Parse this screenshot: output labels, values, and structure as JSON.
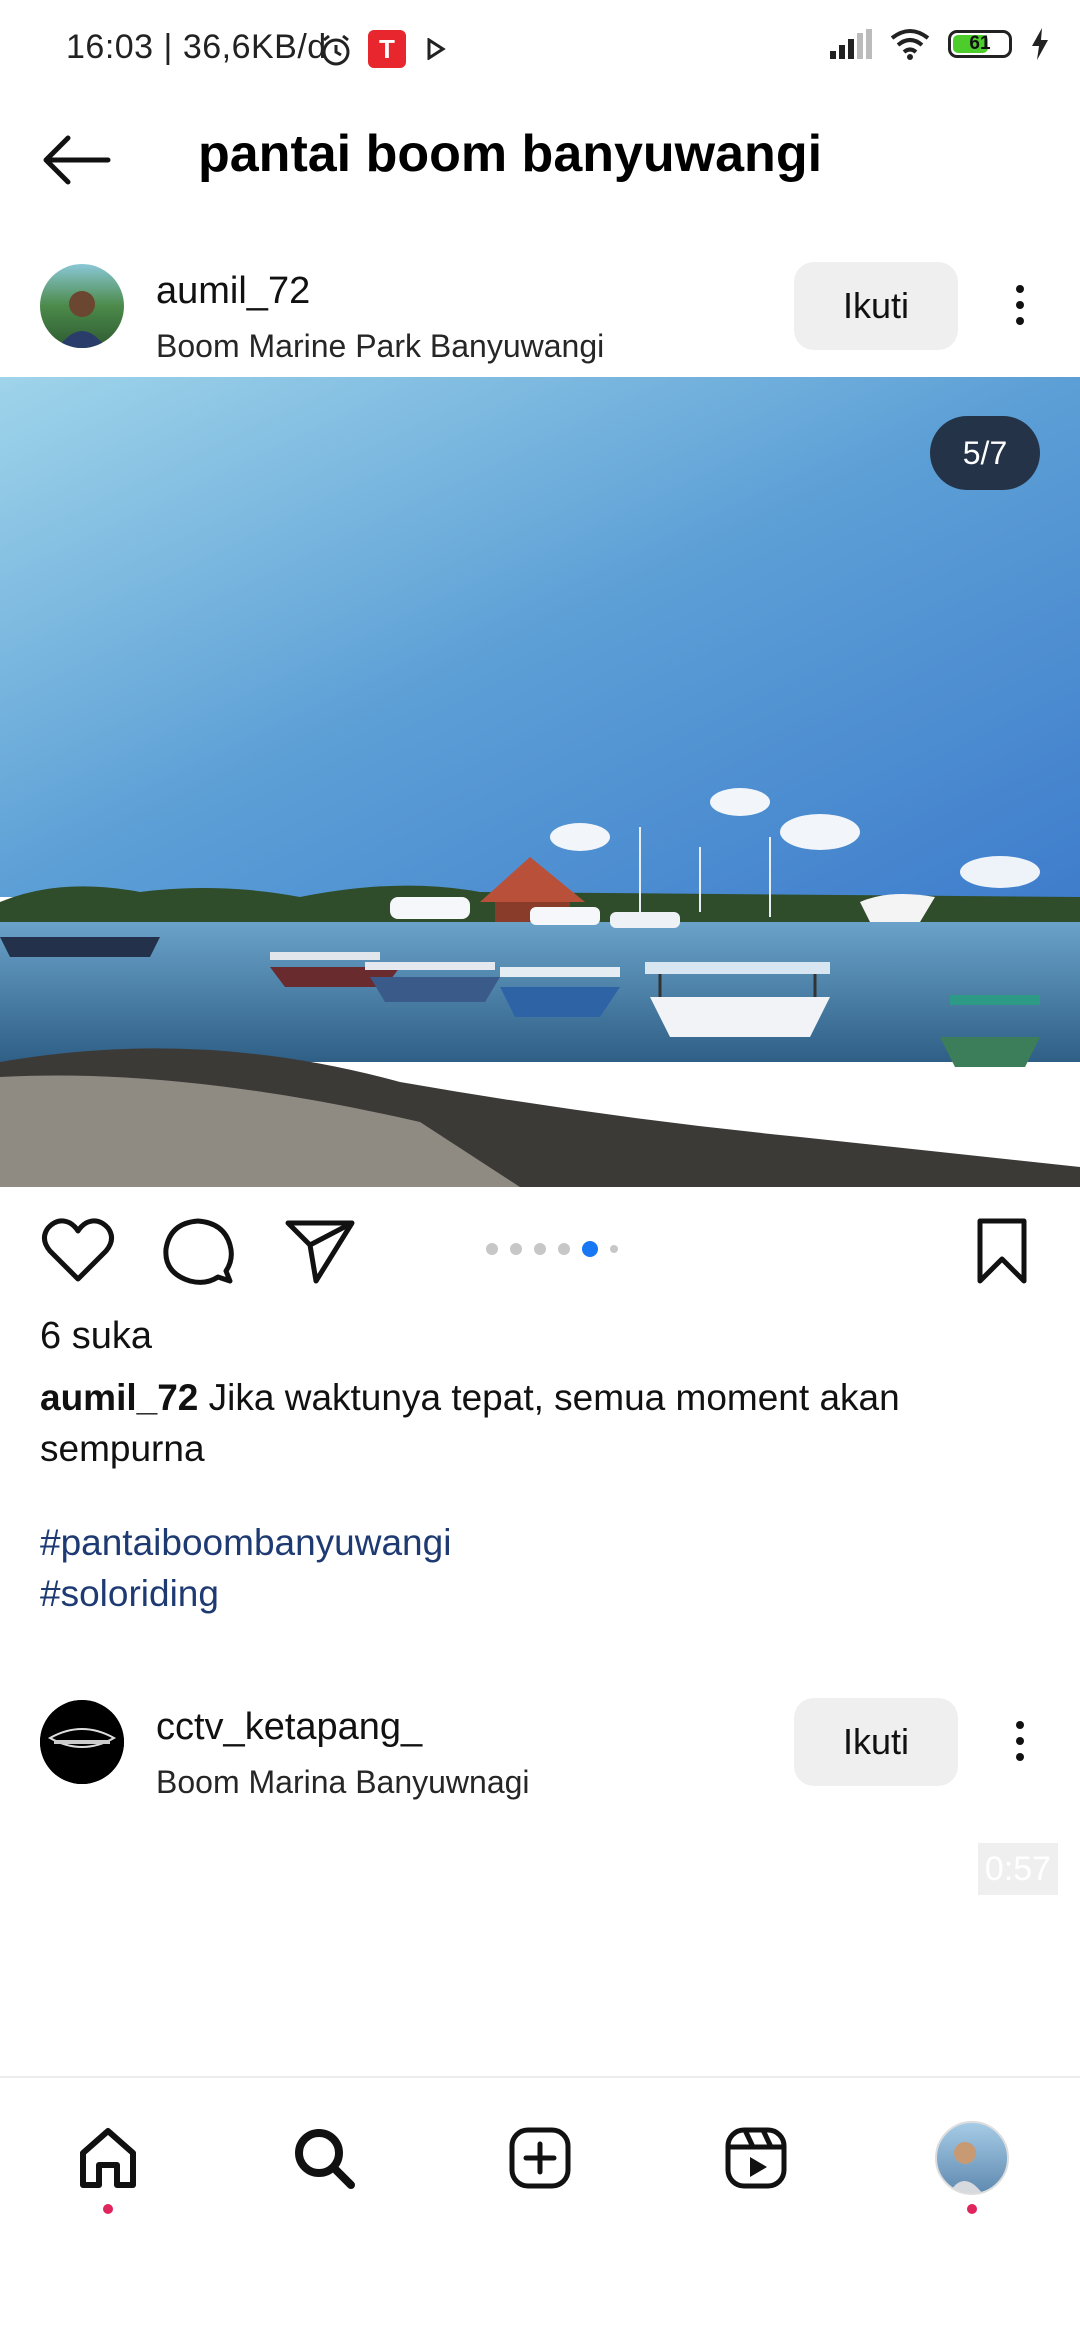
{
  "status_bar": {
    "time": "16:03",
    "speed": "36,6KB/d",
    "battery": "61"
  },
  "header": {
    "title": "pantai boom banyuwangi"
  },
  "post1": {
    "username": "aumil_72",
    "location": "Boom Marine Park Banyuwangi",
    "follow_label": "Ikuti",
    "counter": "5/7",
    "carousel_index": 5,
    "carousel_total": 7,
    "likes": "6 suka",
    "caption_user": "aumil_72",
    "caption_text": "Jika waktunya tepat, semua moment akan sempurna",
    "hashtags": [
      "#pantaiboombanyuwangi",
      "#soloriding"
    ]
  },
  "post2": {
    "username": "cctv_ketapang_",
    "location": "Boom Marina Banyuwnagi",
    "follow_label": "Ikuti",
    "video_time": "0:57"
  },
  "colors": {
    "accent_blue": "#1877f2",
    "hashtag": "#1e3a72",
    "notification_red": "#e0245e"
  },
  "icons": [
    "back-arrow-icon",
    "heart-icon",
    "comment-icon",
    "share-icon",
    "bookmark-icon",
    "home-icon",
    "search-icon",
    "create-icon",
    "reels-icon",
    "profile-icon"
  ]
}
